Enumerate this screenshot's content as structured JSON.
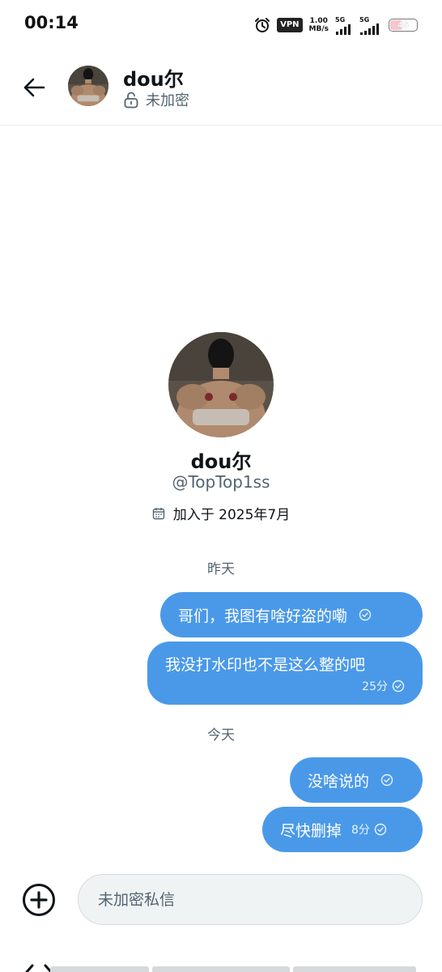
{
  "status_bar": {
    "time": "00:14",
    "vpn": "VPN",
    "speed_value": "1.00",
    "speed_unit": "MB/s",
    "signal1_label": "5G",
    "signal2_label": "5G",
    "battery": "45"
  },
  "header": {
    "back_icon": "arrow-left-icon",
    "name": "dou尔",
    "encryption_icon": "unlock-icon",
    "encryption_status": "未加密"
  },
  "profile": {
    "name": "dou尔",
    "handle": "@TopTop1ss",
    "calendar_icon": "calendar-icon",
    "joined": "加入于 2025年7月"
  },
  "conversation": {
    "day_yesterday": "昨天",
    "day_today": "今天",
    "messages": [
      {
        "text": "哥们，我图有啥好盗的嘞",
        "time": ""
      },
      {
        "text": "我没打水印也不是这么整的吧",
        "time": "25分"
      },
      {
        "text": "没啥说的",
        "time": ""
      },
      {
        "text": "尽快删掉",
        "time": "8分"
      }
    ]
  },
  "composer": {
    "add_icon": "add-circle-icon",
    "placeholder": "未加密私信"
  },
  "colors": {
    "bubble": "#4a99e9",
    "secondary_text": "#536471",
    "input_bg": "#eff3f4"
  }
}
